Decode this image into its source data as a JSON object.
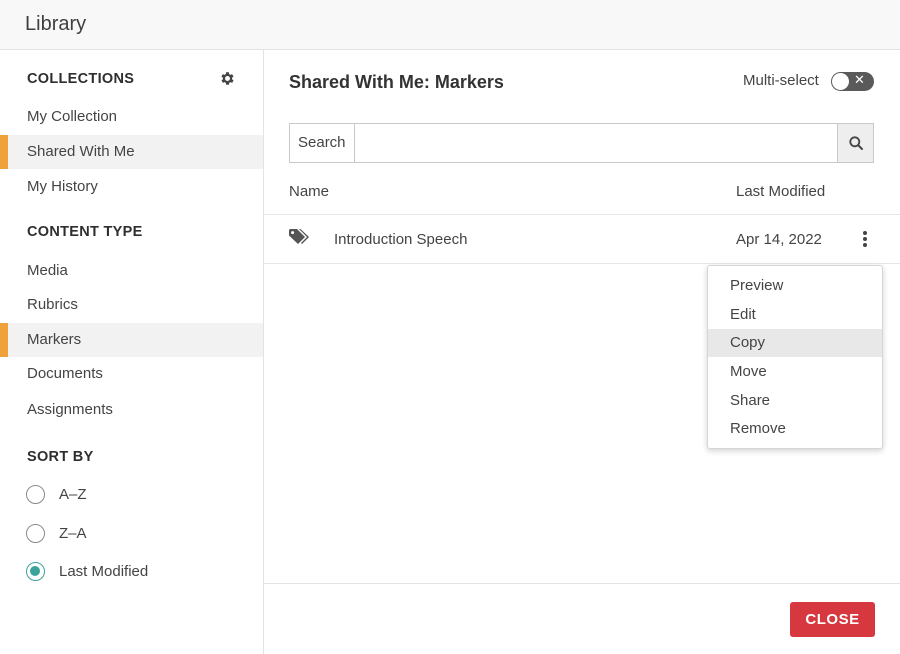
{
  "window": {
    "title": "Library"
  },
  "sidebar": {
    "collections_heading": "COLLECTIONS",
    "collections": [
      {
        "label": "My Collection",
        "active": false
      },
      {
        "label": "Shared With Me",
        "active": true
      },
      {
        "label": "My History",
        "active": false
      }
    ],
    "content_type_heading": "CONTENT TYPE",
    "content_types": [
      {
        "label": "Media",
        "active": false
      },
      {
        "label": "Rubrics",
        "active": false
      },
      {
        "label": "Markers",
        "active": true
      },
      {
        "label": "Documents",
        "active": false
      },
      {
        "label": "Assignments",
        "active": false
      }
    ],
    "sort_heading": "SORT BY",
    "sort_options": [
      {
        "label": "A–Z",
        "checked": false
      },
      {
        "label": "Z–A",
        "checked": false
      },
      {
        "label": "Last Modified",
        "checked": true
      }
    ]
  },
  "main": {
    "title": "Shared With Me: Markers",
    "multi_select_label": "Multi-select",
    "multi_select_on": false,
    "search": {
      "label": "Search",
      "value": "",
      "placeholder": ""
    },
    "columns": {
      "name": "Name",
      "last_modified": "Last Modified"
    },
    "rows": [
      {
        "icon": "tags-icon",
        "name": "Introduction Speech",
        "last_modified": "Apr 14, 2022"
      }
    ]
  },
  "context_menu": {
    "items": [
      "Preview",
      "Edit",
      "Copy",
      "Move",
      "Share",
      "Remove"
    ],
    "highlighted": "Copy"
  },
  "footer": {
    "close_label": "CLOSE"
  },
  "colors": {
    "accent": "#f0a23a",
    "radio": "#3aa39a",
    "close": "#d7373f"
  }
}
